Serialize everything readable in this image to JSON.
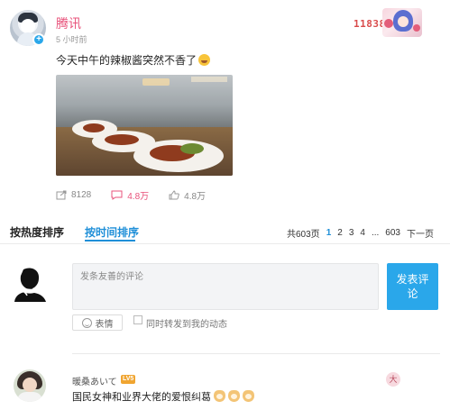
{
  "post": {
    "author": "腾讯",
    "time": "5 小时前",
    "level_number": "118387",
    "text": "今天中午的辣椒酱突然不香了",
    "stats": {
      "forward": "8128",
      "comment": "4.8万",
      "like": "4.8万"
    }
  },
  "comments_header": {
    "tabs": [
      "按热度排序",
      "按时间排序"
    ],
    "active_tab": "按时间排序",
    "pager": {
      "total": "共603页",
      "pages": [
        "1",
        "2",
        "3",
        "4",
        "...",
        "603"
      ],
      "current": "1",
      "next": "下一页"
    }
  },
  "composer": {
    "placeholder": "发条友善的评论",
    "send_label": "发表评论",
    "emoji_label": "表情",
    "share_label": "同时转发到我的动态",
    "share_checked": false
  },
  "comment": {
    "author": "暖桑あいて",
    "level": "LV5",
    "text": "国民女神和业界大佬的爱恨纠葛",
    "medal": "大"
  },
  "colors": {
    "accent": "#1f8fd8",
    "send_button": "#2aa7ea",
    "author_pink": "#e8537b"
  },
  "icons": [
    "vip-badge-icon",
    "forward-icon",
    "comment-icon",
    "like-icon",
    "smile-icon",
    "dog-emoji-icon"
  ]
}
